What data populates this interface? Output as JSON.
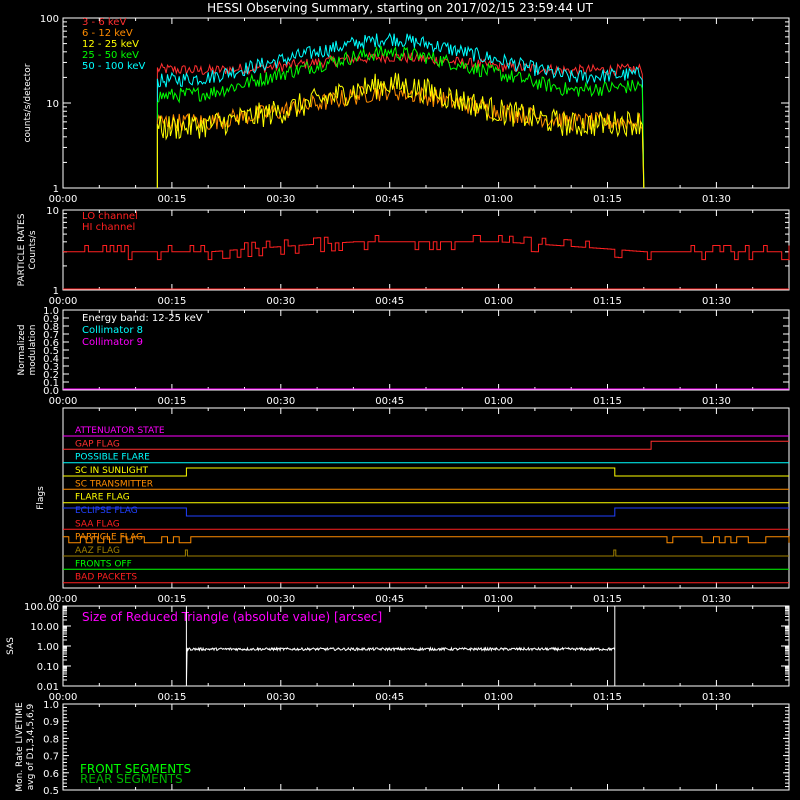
{
  "title": "HESSI Observing Summary, starting on 2017/02/15 23:59:44 UT",
  "colors": {
    "background": "#000000",
    "axes": "#ffffff",
    "e3_6": "#ff3030",
    "e6_12": "#ff8c00",
    "e12_25": "#ffff00",
    "e25_50": "#00ff00",
    "e50_100": "#00ffff",
    "lo_channel": "#ff2020",
    "hi_channel": "#ff2020",
    "energy_band": "#ffffff",
    "collimator8": "#00ffff",
    "collimator9": "#ff00ff",
    "sas": "#ffffff",
    "sas_label": "#ff00ff",
    "front": "#00ff00",
    "rear": "#00b000"
  },
  "x_tick_labels": [
    "00:00",
    "00:15",
    "00:30",
    "00:45",
    "01:00",
    "01:15",
    "01:30"
  ],
  "panels": {
    "counts": {
      "ytitle": "counts/s/detector",
      "y_tick_labels": [
        "1",
        "10",
        "100"
      ],
      "legend": [
        "3 - 6 keV",
        "6 - 12 keV",
        "12 - 25 keV",
        "25 - 50 keV",
        "50 - 100 keV"
      ]
    },
    "particle": {
      "ytitle_line1": "PARTICLE RATES",
      "ytitle_line2": "Counts/s",
      "y_tick_labels": [
        "1",
        "10"
      ],
      "legend": [
        "LO channel",
        "HI channel"
      ]
    },
    "modulation": {
      "ytitle_line1": "Normalized",
      "ytitle_line2": "modulation",
      "y_tick_labels": [
        "0.0",
        "0.1",
        "0.2",
        "0.3",
        "0.4",
        "0.5",
        "0.6",
        "0.7",
        "0.8",
        "0.9",
        "1.0"
      ],
      "legend": [
        "Energy band: 12-25 keV",
        "Collimator 8",
        "Collimator 9"
      ]
    },
    "flags": {
      "ytitle": "Flags",
      "items": [
        {
          "label": "ATTENUATOR STATE",
          "color": "#ff00ff"
        },
        {
          "label": "GAP FLAG",
          "color": "#ff3030"
        },
        {
          "label": "POSSIBLE FLARE",
          "color": "#00ffff"
        },
        {
          "label": "SC IN SUNLIGHT",
          "color": "#ffff00"
        },
        {
          "label": "SC TRANSMITTER",
          "color": "#ff8c00"
        },
        {
          "label": "FLARE FLAG",
          "color": "#ffff00"
        },
        {
          "label": "ECLIPSE FLAG",
          "color": "#2040ff"
        },
        {
          "label": "SAA FLAG",
          "color": "#ff2020"
        },
        {
          "label": "PARTICLE FLAG",
          "color": "#ff8c00"
        },
        {
          "label": "AAZ FLAG",
          "color": "#a08000"
        },
        {
          "label": "FRONTS OFF",
          "color": "#00ff00"
        },
        {
          "label": "BAD PACKETS",
          "color": "#ff2020"
        }
      ]
    },
    "sas": {
      "ytitle": "SAS",
      "y_tick_labels": [
        "0.01",
        "0.10",
        "1.00",
        "10.00",
        "100.00"
      ],
      "label": "Size of Reduced Triangle (absolute value) [arcsec]"
    },
    "livetime": {
      "ytitle_line1": "Mon. Rate LIVETIME",
      "ytitle_line2": "avg of D1,3,4,5,6,9",
      "y_tick_labels": [
        "0.5",
        "0.6",
        "0.7",
        "0.8",
        "0.9",
        "1.0"
      ],
      "legend": [
        "FRONT SEGMENTS",
        "REAR SEGMENTS"
      ]
    }
  },
  "chart_data": {
    "type": "line",
    "x_unit": "UT time since 2017/02/15 23:59:44",
    "x_range": [
      "00:00",
      "01:40"
    ],
    "counts": {
      "ylim": [
        1,
        100
      ],
      "log": true,
      "x": [
        "00:13",
        "00:20",
        "00:30",
        "00:40",
        "00:45",
        "00:50",
        "01:00",
        "01:10",
        "01:20"
      ],
      "series": [
        {
          "name": "3 - 6 keV",
          "values": [
            25,
            24,
            27,
            33,
            35,
            33,
            27,
            24,
            25
          ]
        },
        {
          "name": "6 - 12 keV",
          "values": [
            6,
            6,
            8,
            12,
            14,
            12,
            8,
            6,
            6
          ]
        },
        {
          "name": "12 - 25 keV",
          "values": [
            5,
            5.5,
            8,
            14,
            17,
            14,
            8,
            5.5,
            6
          ]
        },
        {
          "name": "25 - 50 keV",
          "values": [
            12,
            13,
            22,
            35,
            40,
            35,
            22,
            14,
            16
          ]
        },
        {
          "name": "50 - 100 keV",
          "values": [
            18,
            20,
            32,
            50,
            58,
            50,
            32,
            20,
            22
          ]
        }
      ],
      "data_start": "00:13",
      "data_end": "01:20"
    },
    "particle": {
      "ylim": [
        1,
        10
      ],
      "log": true,
      "x": [
        "00:00",
        "00:20",
        "00:30",
        "00:40",
        "00:50",
        "01:00",
        "01:10",
        "01:20",
        "01:30",
        "01:40"
      ],
      "series": [
        {
          "name": "LO channel",
          "values": [
            3,
            3,
            3.5,
            4,
            4,
            4,
            3.5,
            3,
            3,
            3
          ]
        },
        {
          "name": "HI channel",
          "values": [
            1,
            1,
            1,
            1,
            1,
            1,
            1,
            1,
            1,
            1
          ]
        }
      ]
    },
    "modulation": {
      "ylim": [
        0,
        1
      ],
      "series": [
        {
          "name": "Collimator 9",
          "values": [
            0,
            0
          ]
        }
      ]
    },
    "flags": {
      "SC IN SUNLIGHT": {
        "on_start": "00:17",
        "on_end": "01:16"
      },
      "ECLIPSE FLAG": {
        "off_start": "00:17",
        "off_end": "01:16"
      },
      "GAP FLAG": {
        "high_from": "01:21"
      }
    },
    "sas": {
      "ylim": [
        0.01,
        100
      ],
      "log": true,
      "start": "00:17",
      "end": "01:16",
      "typical_value": 0.7,
      "spike_value": 100
    },
    "livetime": {
      "ylim": [
        0.5,
        1.0
      ]
    }
  }
}
